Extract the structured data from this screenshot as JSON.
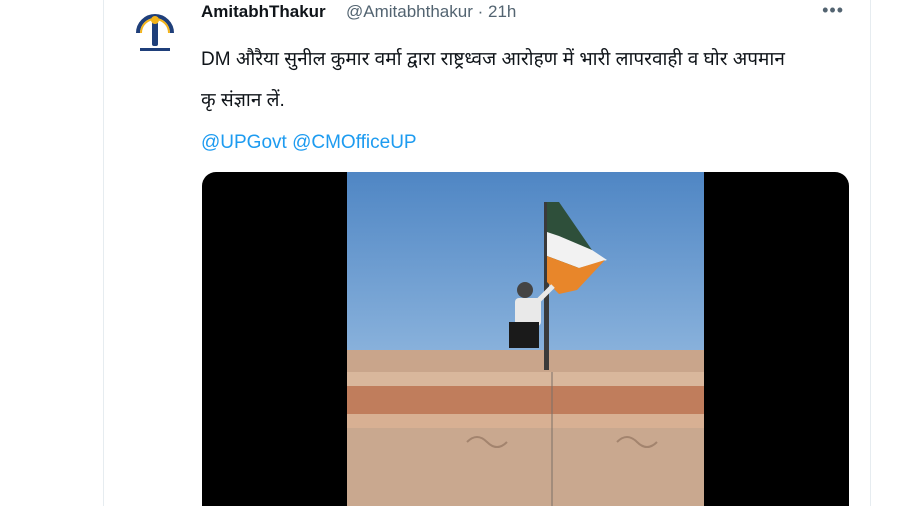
{
  "tweet": {
    "display_name": "AmitabhThakur",
    "handle": "@Amitabhthakur",
    "separator": "·",
    "time": "21h",
    "more_icon": "more-dots-icon",
    "text_line1": "DM औरैया सुनील कुमार वर्मा द्वारा राष्ट्रध्वज आरोहण में भारी लापरवाही व घोर अपमान",
    "text_line2": "कृ संज्ञान लें.",
    "mentions": [
      "@UPGovt",
      "@CMOfficeUP"
    ]
  },
  "colors": {
    "link": "#1d9bf0",
    "secondary_text": "#536471",
    "border": "#e6ecf0"
  }
}
